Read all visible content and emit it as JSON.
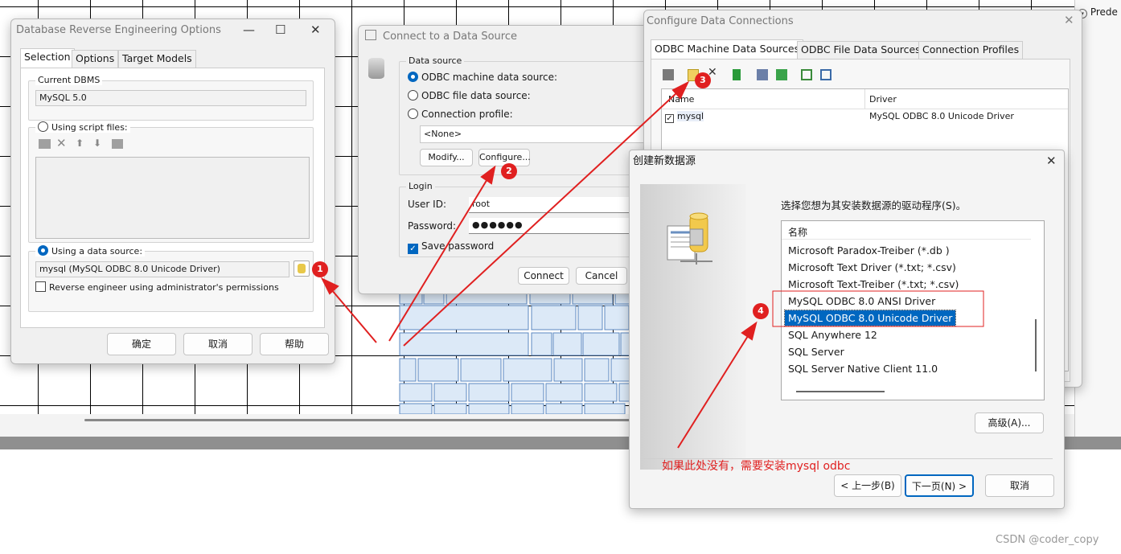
{
  "background": {
    "status_text": "Prede"
  },
  "reverse_dialog": {
    "title": "Database Reverse Engineering Options",
    "tabs": [
      "Selection",
      "Options",
      "Target Models"
    ],
    "current_dbms_label": "Current DBMS",
    "current_dbms_value": "MySQL 5.0",
    "script_files_label": "Using script files:",
    "data_source_label": "Using a data source:",
    "data_source_value": "mysql (MySQL ODBC 8.0 Unicode Driver)",
    "admin_label": "Reverse engineer using administrator's permissions",
    "buttons": {
      "ok": "确定",
      "cancel": "取消",
      "help": "帮助"
    }
  },
  "connect_dialog": {
    "title": "Connect to a Data Source",
    "data_source_group": "Data source",
    "odbc_machine": "ODBC machine data source:",
    "odbc_file": "ODBC file data source:",
    "connection_profile": "Connection profile:",
    "profile_value": "<None>",
    "modify_button": "Modify...",
    "configure_button": "Configure...",
    "login_group": "Login",
    "user_id_label": "User ID:",
    "user_id_value": "root",
    "password_label": "Password:",
    "password_value": "●●●●●●",
    "save_password": "Save password",
    "connect_button": "Connect",
    "cancel_button": "Cancel"
  },
  "config_dialog": {
    "title": "Configure Data Connections",
    "tabs": [
      "ODBC Machine Data Sources",
      "ODBC File Data Sources",
      "Connection Profiles"
    ],
    "col_name": "Name",
    "col_driver": "Driver",
    "rows": [
      {
        "name": "mysql",
        "driver": "MySQL ODBC 8.0 Unicode Driver"
      }
    ]
  },
  "new_ds_dialog": {
    "title": "创建新数据源",
    "prompt": "选择您想为其安装数据源的驱动程序(S)。",
    "list_header": "名称",
    "drivers": [
      "Microsoft Paradox-Treiber (*.db )",
      "Microsoft Text Driver (*.txt; *.csv)",
      "Microsoft Text-Treiber (*.txt; *.csv)",
      "MySQL ODBC 8.0 ANSI Driver",
      "MySQL ODBC 8.0 Unicode Driver",
      "SQL Anywhere 12",
      "SQL Server",
      "SQL Server Native Client 11.0"
    ],
    "selected_index": 4,
    "advanced_button": "高级(A)...",
    "back_button": "< 上一步(B)",
    "next_button": "下一页(N) >",
    "cancel_button": "取消"
  },
  "annotations": {
    "markers": [
      "1",
      "2",
      "3",
      "4"
    ],
    "note": "如果此处没有，需要安装mysql odbc",
    "color": "#e02020"
  },
  "watermark": "CSDN @coder_copy"
}
